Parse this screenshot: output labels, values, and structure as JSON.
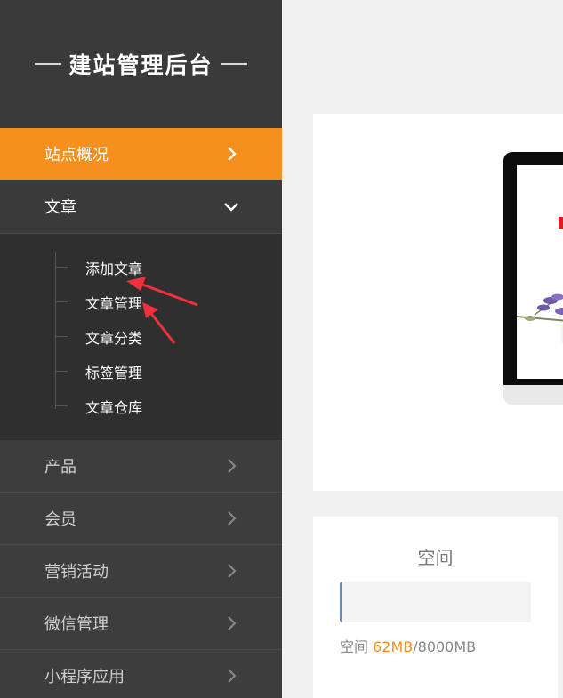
{
  "brand": {
    "title": "建站管理后台"
  },
  "nav": {
    "overview": "站点概况",
    "article": "文章",
    "article_sub": [
      "添加文章",
      "文章管理",
      "文章分类",
      "标签管理",
      "文章仓库"
    ],
    "product": "产品",
    "member": "会员",
    "marketing": "营销活动",
    "wechat": "微信管理",
    "miniprogram": "小程序应用"
  },
  "space": {
    "title": "空间",
    "label": "空间",
    "used": "62MB",
    "separator": "/",
    "total": "8000MB"
  },
  "colors": {
    "accent": "#f5901f",
    "sidebar": "#3a3a3a",
    "annotation_arrow": "#f0303a"
  }
}
